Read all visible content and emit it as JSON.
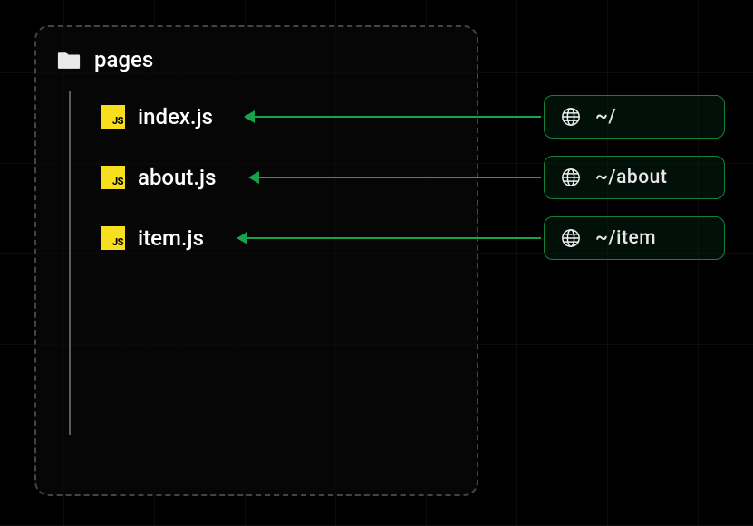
{
  "folder": {
    "name": "pages"
  },
  "files": [
    {
      "name": "index.js",
      "route": "~/"
    },
    {
      "name": "about.js",
      "route": "~/about"
    },
    {
      "name": "item.js",
      "route": "~/item"
    }
  ],
  "icons": {
    "js_badge": "JS"
  }
}
